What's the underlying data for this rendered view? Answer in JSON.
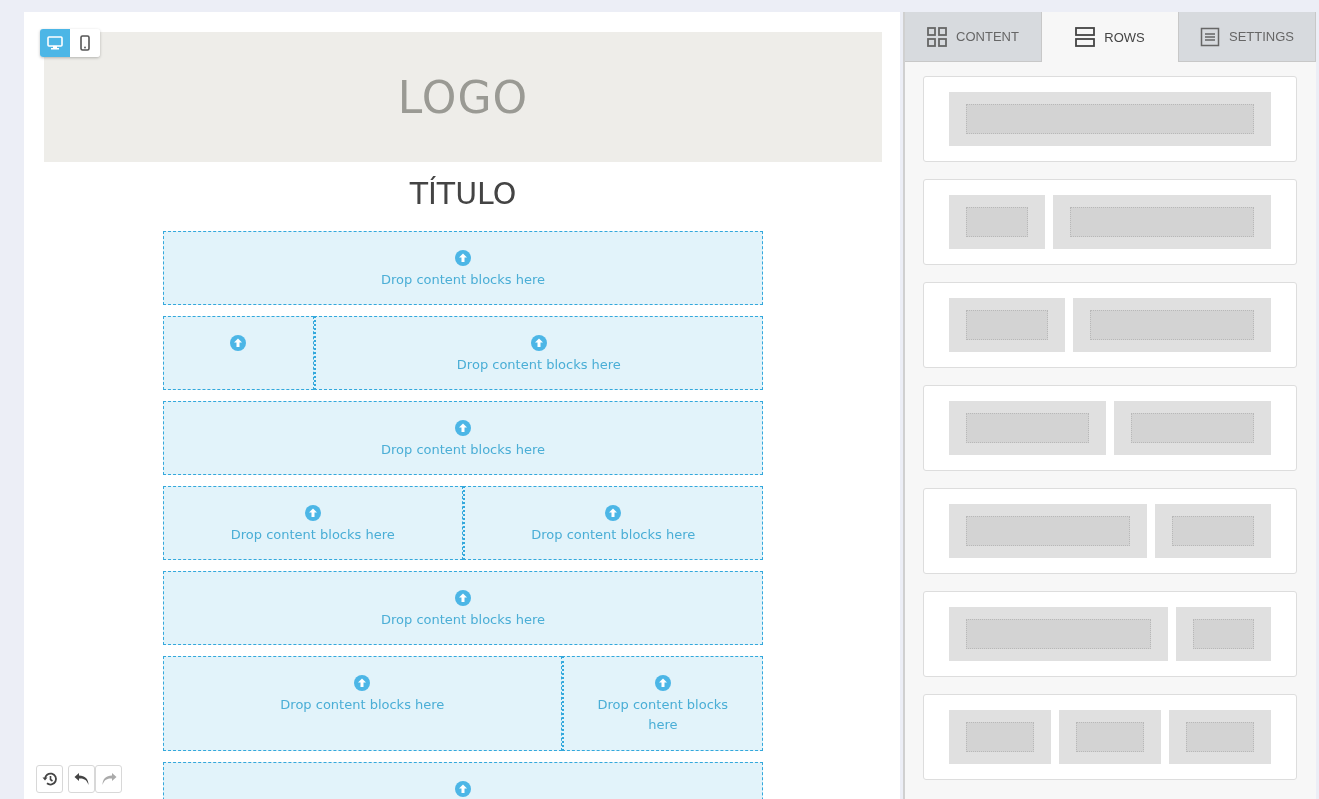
{
  "device_toggle": [
    {
      "kind": "desktop",
      "selected": true
    },
    {
      "kind": "mobile",
      "selected": false
    }
  ],
  "header": {
    "logo": "LOGO",
    "title": "TÍTULO"
  },
  "rows": [
    {
      "kind": "full",
      "columns": [
        {
          "text": "Drop content blocks here"
        }
      ]
    },
    {
      "kind": "narrow-wide",
      "columns": [
        {},
        {
          "text": "Drop content blocks here"
        }
      ]
    },
    {
      "kind": "full",
      "columns": [
        {
          "text": "Drop content blocks here"
        }
      ]
    },
    {
      "kind": "halves",
      "columns": [
        {
          "text": "Drop content blocks here"
        },
        {
          "text": "Drop content blocks here"
        }
      ]
    },
    {
      "kind": "full",
      "columns": [
        {
          "text": "Drop content blocks here"
        }
      ]
    },
    {
      "kind": "wide-third",
      "columns": [
        {
          "text": "Drop content blocks here"
        },
        {
          "text": "Drop content blocks here"
        }
      ]
    },
    {
      "kind": "full",
      "columns": [
        {}
      ]
    }
  ],
  "history_controls": [
    {
      "kind": "history",
      "disabled": false
    },
    {
      "kind": "undo",
      "disabled": false
    },
    {
      "kind": "redo",
      "disabled": true
    }
  ],
  "tabs": [
    {
      "kind": "content",
      "label": "CONTENT",
      "selected": false
    },
    {
      "kind": "rows",
      "label": "ROWS",
      "selected": true
    },
    {
      "kind": "settings",
      "label": "SETTINGS",
      "selected": false
    }
  ],
  "row_layouts": [
    {
      "kind": "full"
    },
    {
      "kind": "narrow-wide"
    },
    {
      "kind": "third-wide"
    },
    {
      "kind": "halves"
    },
    {
      "kind": "wide-third"
    },
    {
      "kind": "wide-narrow"
    },
    {
      "kind": "thirds"
    }
  ]
}
